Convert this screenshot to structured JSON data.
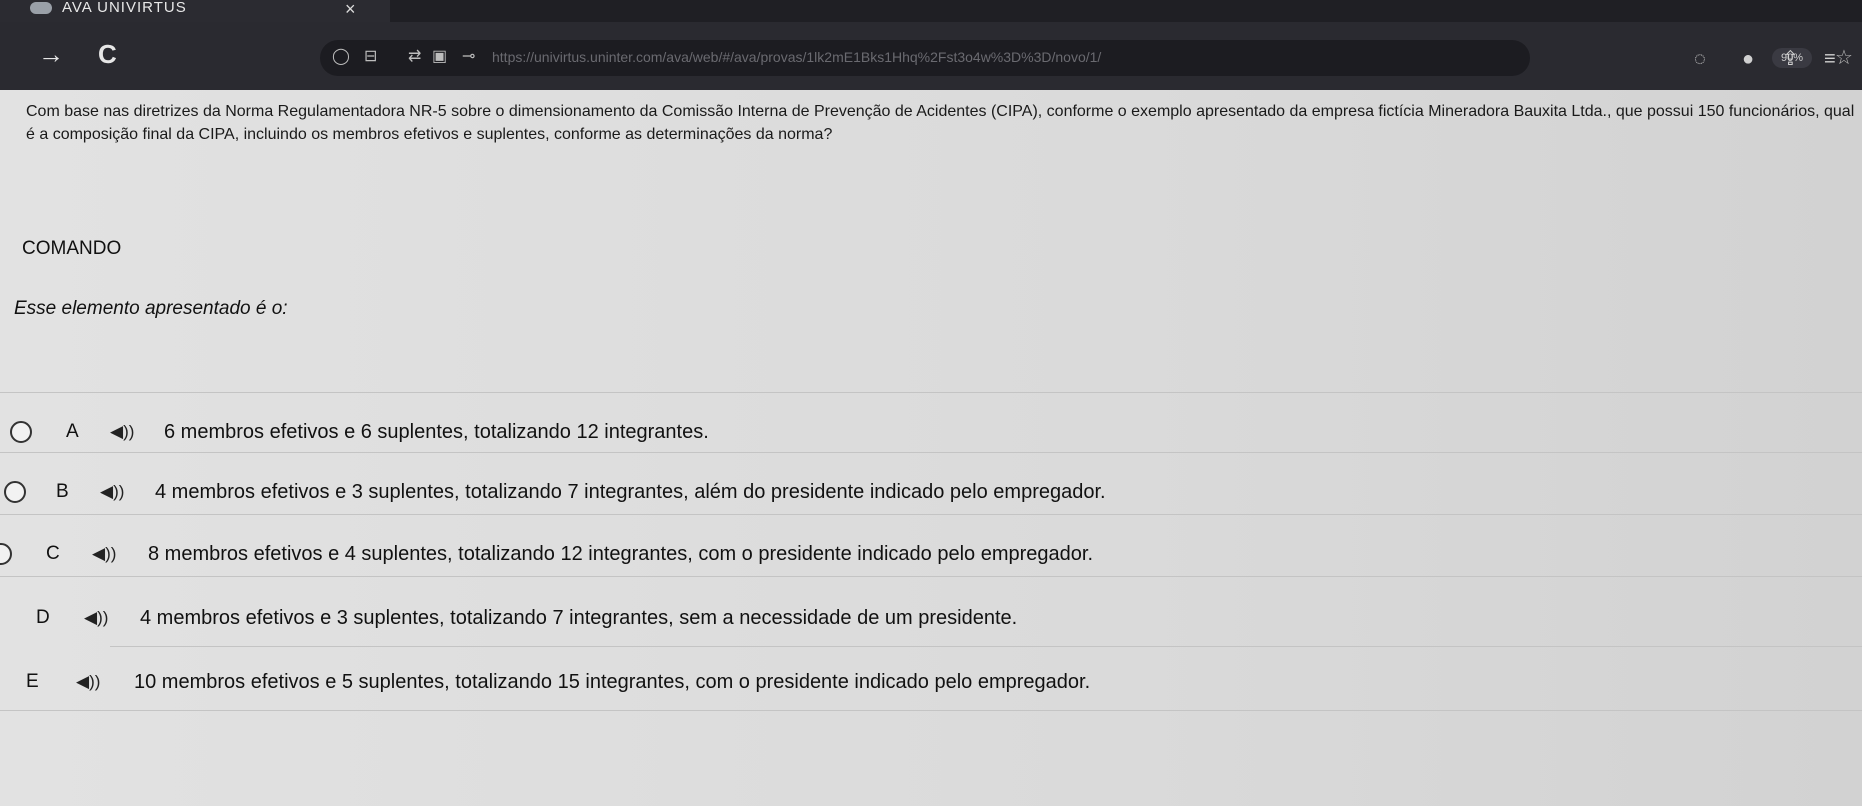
{
  "browser": {
    "tab_title": "AVA UNIVIRTUS",
    "tab_close": "×",
    "back_icon": "→",
    "reload_icon": "C",
    "url": "https://univirtus.uninter.com/ava/web/#/ava/provas/1lk2mE1Bks1Hhq%2Fst3o4w%3D%3D/novo/1/",
    "zoom": "90%"
  },
  "question": {
    "text": "Com base nas diretrizes da Norma Regulamentadora NR-5 sobre o dimensionamento da Comissão Interna de Prevenção de Acidentes (CIPA), conforme o exemplo apresentado da empresa fictícia Mineradora Bauxita Ltda., que possui 150 funcionários, qual é a composição final da CIPA, incluindo os membros efetivos e suplentes, conforme as determinações da norma?",
    "command_label": "COMANDO",
    "stem": "Esse elemento apresentado é o:"
  },
  "options": [
    {
      "letter": "A",
      "text": "6 membros efetivos e 6 suplentes, totalizando 12 integrantes."
    },
    {
      "letter": "B",
      "text": "4 membros efetivos e 3 suplentes, totalizando 7 integrantes, além do presidente indicado pelo empregador."
    },
    {
      "letter": "C",
      "text": "8 membros efetivos e 4 suplentes, totalizando 12 integrantes, com o presidente indicado pelo empregador."
    },
    {
      "letter": "D",
      "text": "4 membros efetivos e 3 suplentes, totalizando 7 integrantes, sem a necessidade de um presidente."
    },
    {
      "letter": "E",
      "text": "10 membros efetivos e 5 suplentes, totalizando 15 integrantes, com o presidente indicado pelo empregador."
    }
  ]
}
